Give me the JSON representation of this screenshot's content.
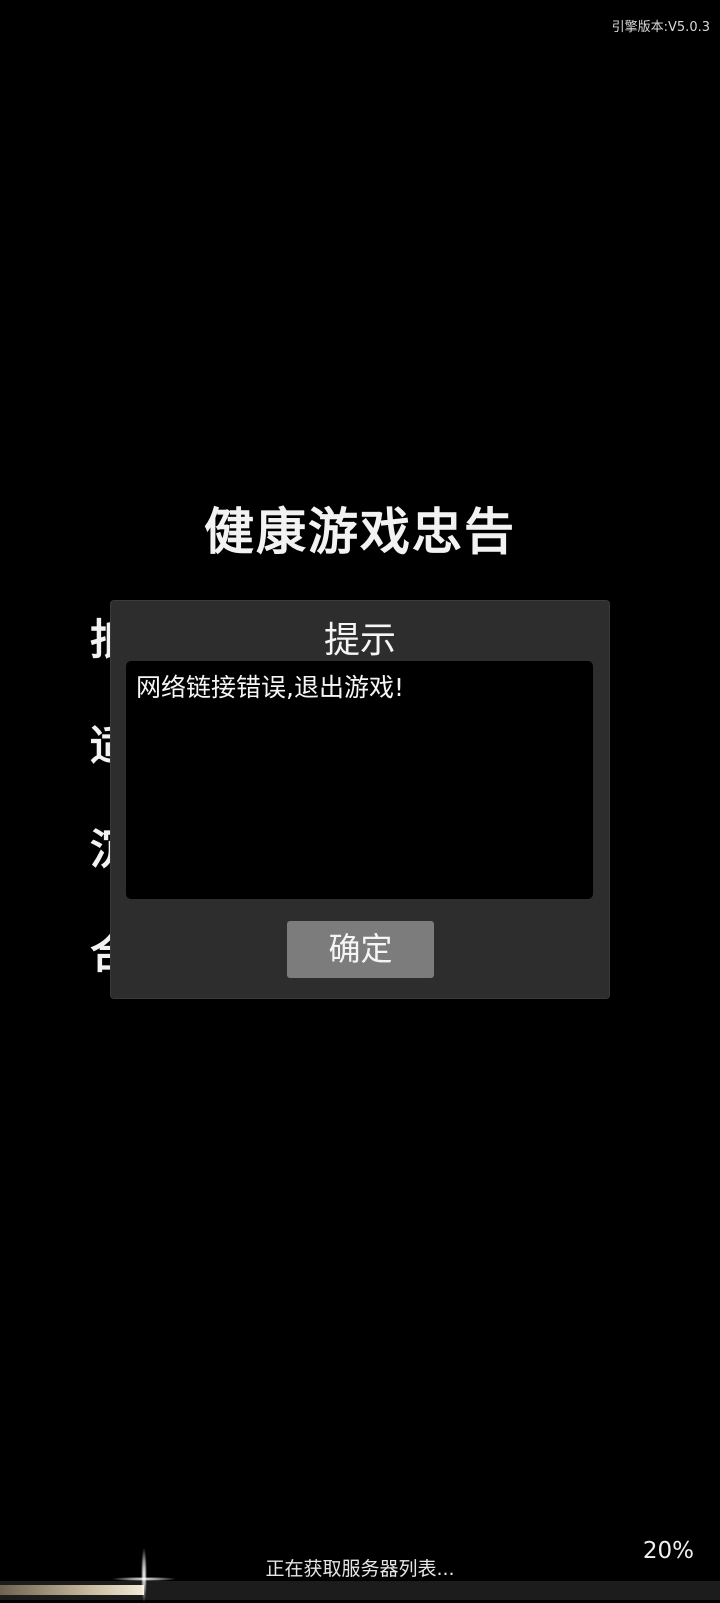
{
  "engine_version": "引擎版本:V5.0.3",
  "advisory": {
    "title": "健康游戏忠告",
    "lines": [
      {
        "first": "抵",
        "last": "。"
      },
      {
        "first": "适",
        "last": "。"
      },
      {
        "first": "沉",
        "last": "。"
      },
      {
        "first": "合",
        "last": "。"
      }
    ]
  },
  "dialog": {
    "title": "提示",
    "message": "网络链接错误,退出游戏!",
    "ok_label": "确定"
  },
  "loading": {
    "status": "正在获取服务器列表...",
    "percent_label": "20%",
    "progress": 0.2
  }
}
